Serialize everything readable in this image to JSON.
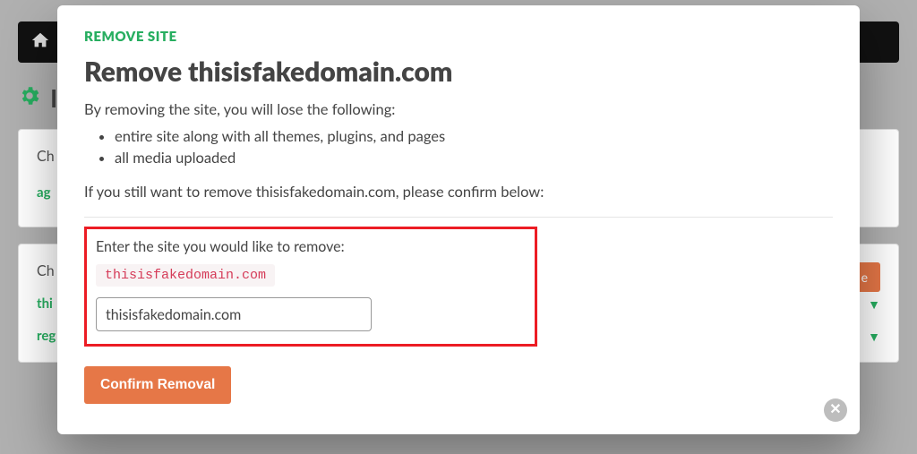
{
  "background": {
    "heading_fragment": "I",
    "card1": {
      "label_fragment": "Ch",
      "link_fragment": "ag"
    },
    "card2": {
      "label_fragment": "Ch",
      "button_fragment": "e",
      "row1_fragment": "thi",
      "row2_fragment": "reg"
    }
  },
  "modal": {
    "eyebrow": "REMOVE SITE",
    "title": "Remove thisisfakedomain.com",
    "intro": "By removing the site, you will lose the following:",
    "bullets": [
      "entire site along with all themes, plugins, and pages",
      "all media uploaded"
    ],
    "confirm_text": "If you still want to remove thisisfakedomain.com, please confirm below:",
    "enter_label": "Enter the site you would like to remove:",
    "domain_code": "thisisfakedomain.com",
    "input_value": "thisisfakedomain.com",
    "confirm_button": "Confirm Removal"
  }
}
